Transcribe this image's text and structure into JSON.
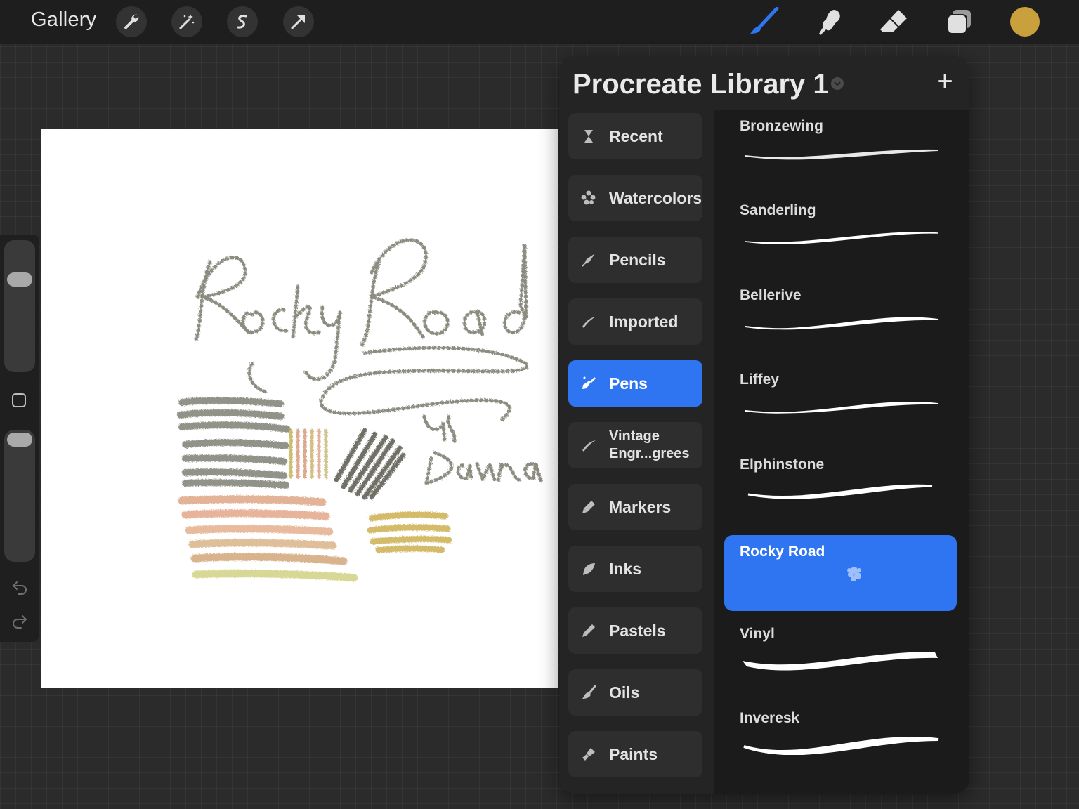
{
  "topbar": {
    "gallery_label": "Gallery",
    "left_tools": [
      "wrench-icon",
      "magic-wand-icon",
      "selection-icon",
      "transform-arrow-icon"
    ],
    "right_tools": [
      "brush-icon",
      "smudge-icon",
      "eraser-icon",
      "layers-icon"
    ],
    "active_tool": "brush-icon",
    "current_color": "#c9a13c"
  },
  "canvas": {
    "artwork_text": [
      "Rocky Road",
      "By",
      "Dawna"
    ]
  },
  "sidebar": {
    "brush_size_level": 0.72,
    "opacity_level": 0.93,
    "icons": [
      "modifier-square-icon",
      "undo-icon",
      "redo-icon"
    ]
  },
  "library": {
    "title": "Procreate Library 1",
    "add_label": "+",
    "sets": [
      {
        "label": "Recent",
        "icon": "hourglass-icon"
      },
      {
        "label": "Watercolors",
        "icon": "watercolor-drops-icon"
      },
      {
        "label": "Pencils",
        "icon": "pencil-icon"
      },
      {
        "label": "Imported",
        "icon": "stroke-icon"
      },
      {
        "label": "Pens",
        "icon": "pen-icon",
        "active": true
      },
      {
        "label": "Vintage Engr...grees",
        "icon": "stroke-icon"
      },
      {
        "label": "Markers",
        "icon": "marker-icon"
      },
      {
        "label": "Inks",
        "icon": "ink-icon"
      },
      {
        "label": "Pastels",
        "icon": "pastel-icon"
      },
      {
        "label": "Oils",
        "icon": "oil-brush-icon"
      },
      {
        "label": "Paints",
        "icon": "paint-brush-icon"
      }
    ],
    "brushes": [
      {
        "name": "Bronzewing"
      },
      {
        "name": "Sanderling"
      },
      {
        "name": "Bellerive"
      },
      {
        "name": "Liffey"
      },
      {
        "name": "Elphinstone"
      },
      {
        "name": "Rocky Road",
        "active": true
      },
      {
        "name": "Vinyl"
      },
      {
        "name": "Inveresk"
      }
    ],
    "accent_color": "#2f74f0"
  }
}
